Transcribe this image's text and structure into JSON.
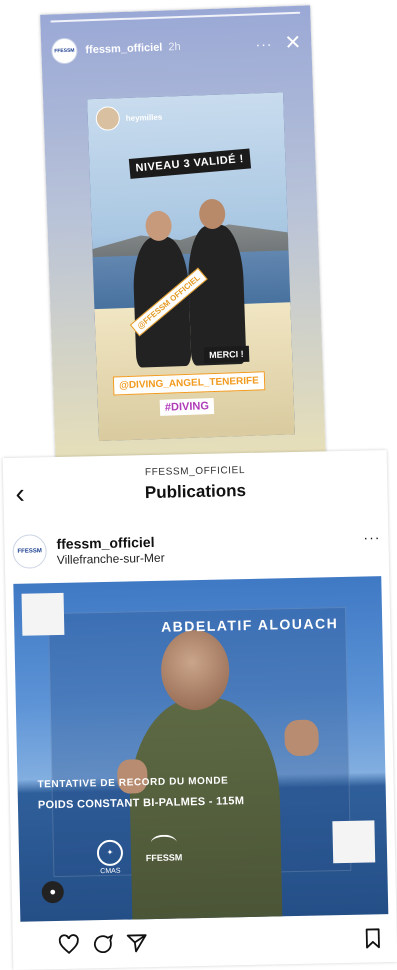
{
  "story": {
    "username": "ffessm_officiel",
    "time": "2h",
    "more_icon": "more-horizontal-icon",
    "close_icon": "close-icon",
    "repost": {
      "username": "heymilles",
      "stickers": {
        "level": "NIVEAU 3 VALIDÉ !",
        "ffessm_tag": "@FFESSM OFFICIEL",
        "merci": "MERCI !",
        "diving_angel": "@DIVING_ANGEL_TENERIFE",
        "hashtag": "#DIVING"
      }
    }
  },
  "publications": {
    "nav": {
      "account": "FFESSM_OFFICIEL",
      "title": "Publications",
      "back_icon": "chevron-left-icon"
    },
    "post": {
      "username": "ffessm_officiel",
      "location": "Villefranche-sur-Mer",
      "avatar_text": "FFESSM",
      "image_overlay": {
        "name": "ABDELATIF ALOUACH",
        "line1": "TENTATIVE DE RECORD DU MONDE",
        "line2": "POIDS CONSTANT BI-PALMES - 115M",
        "logo_left": "CMAS",
        "logo_right": "FFESSM"
      },
      "actions": {
        "like_icon": "heart-icon",
        "comment_icon": "comment-icon",
        "share_icon": "send-icon",
        "save_icon": "bookmark-icon"
      }
    }
  },
  "colors": {
    "story_gradient_top": "#9aa8d6",
    "story_gradient_bottom": "#e8e0b8",
    "sea_blue": "#3f79c4",
    "sticker_orange": "#f29a1e"
  }
}
